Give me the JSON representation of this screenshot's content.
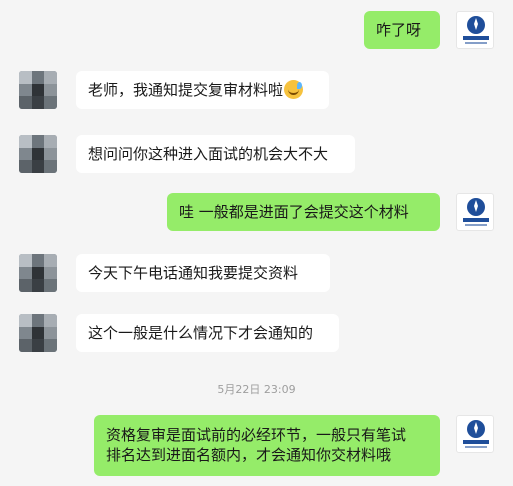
{
  "messages": [
    {
      "side": "out",
      "text": "咋了呀"
    },
    {
      "side": "in",
      "text": "老师，我通知提交复审材料啦",
      "emoji": "sweat-smile-emoji"
    },
    {
      "side": "in",
      "text": "想问问你这种进入面试的机会大不大"
    },
    {
      "side": "out",
      "text": "哇 一般都是进面了会提交这个材料"
    },
    {
      "side": "in",
      "text": "今天下午电话通知我要提交资料"
    },
    {
      "side": "in",
      "text": "这个一般是什么情况下才会通知的"
    },
    {
      "side": "out",
      "lines": [
        "资格复审是面试前的必经环节，一般只有笔试",
        "排名达到进面名额内，才会通知你交材料哦"
      ]
    }
  ],
  "timestamp": "5月22日 23:09",
  "avatars": {
    "teacher": {
      "icon": "zhongxing-education-logo",
      "text_top": "中星教育",
      "text_bottom": "ZHONG XING EDUCATION"
    },
    "student": {
      "icon": "pixelated-avatar"
    }
  },
  "colors": {
    "background": "#f5f5f5",
    "incoming": "#ffffff",
    "outgoing": "#95ec69",
    "logo_blue": "#1f4e9a"
  }
}
